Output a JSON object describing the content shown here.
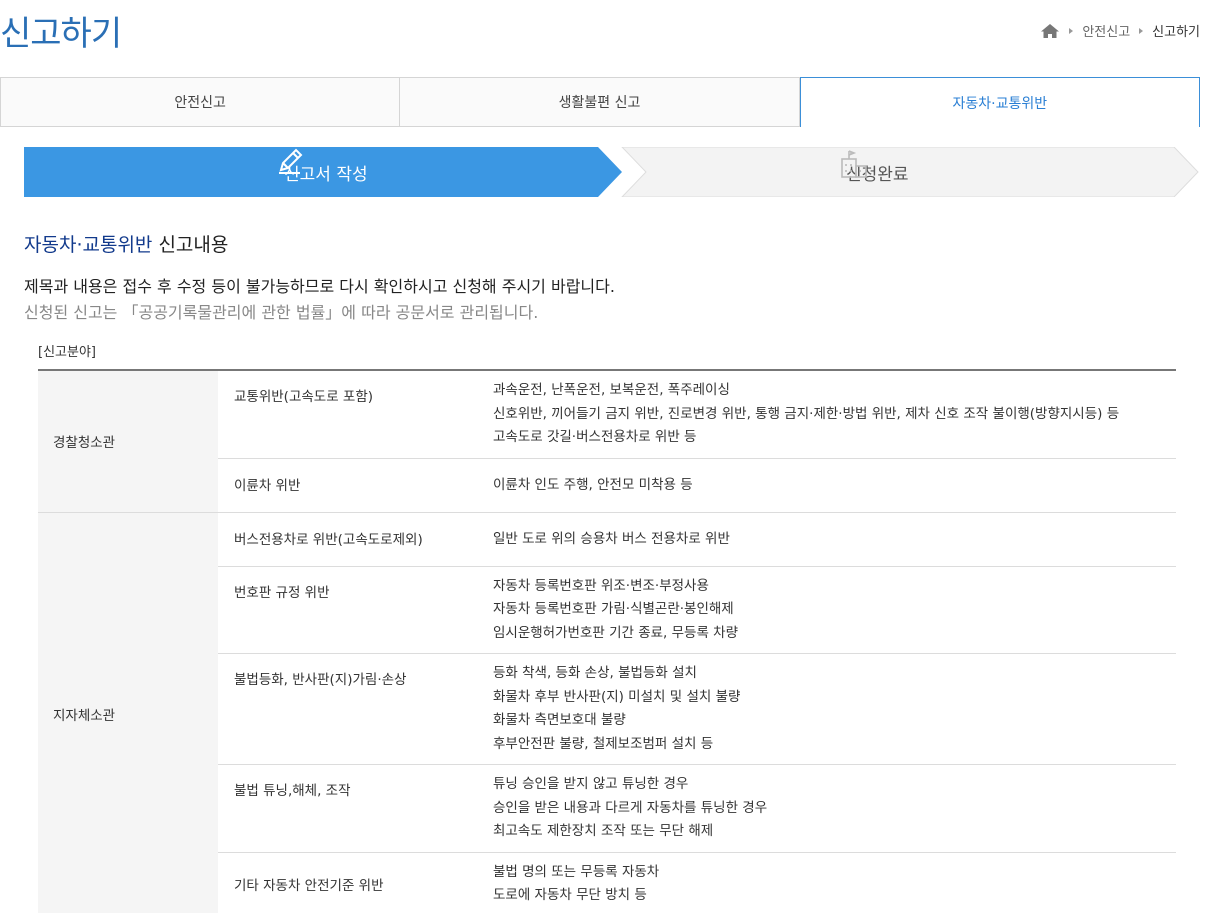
{
  "page": {
    "title": "신고하기",
    "breadcrumb": [
      "안전신고",
      "신고하기"
    ]
  },
  "tabs": [
    {
      "label": "안전신고",
      "active": false
    },
    {
      "label": "생활불편 신고",
      "active": false
    },
    {
      "label": "자동차·교통위반",
      "active": true
    }
  ],
  "steps": [
    {
      "label": "신고서 작성",
      "active": true,
      "icon": "pencil-icon"
    },
    {
      "label": "신청완료",
      "active": false,
      "icon": "building-flag-icon"
    }
  ],
  "section": {
    "title_highlight": "자동차·교통위반",
    "title_rest": " 신고내용",
    "notice_main": "제목과 내용은 접수 후 수정 등이 불가능하므로 다시 확인하시고 신청해 주시기 바랍니다.",
    "notice_sub": "신청된 신고는 「공공기록물관리에 관한 법률」에 따라 공문서로 관리됩니다.",
    "field_label": "[신고분야]"
  },
  "table": {
    "groups": [
      {
        "agency": "경찰청소관",
        "rows": [
          {
            "category": "교통위반(고속도로 포함)",
            "descriptions": [
              "과속운전, 난폭운전, 보복운전, 폭주레이싱",
              "신호위반, 끼어들기 금지 위반, 진로변경 위반, 통행 금지·제한·방법 위반, 제차 신호 조작 불이행(방향지시등) 등",
              "고속도로 갓길·버스전용차로 위반 등"
            ]
          },
          {
            "category": "이륜차 위반",
            "descriptions": [
              "이륜차 인도 주행, 안전모 미착용 등"
            ]
          }
        ]
      },
      {
        "agency": "지자체소관",
        "rows": [
          {
            "category": "버스전용차로 위반(고속도로제외)",
            "descriptions": [
              "일반 도로 위의 승용차 버스 전용차로 위반"
            ]
          },
          {
            "category": "번호판 규정 위반",
            "descriptions": [
              "자동차 등록번호판 위조·변조·부정사용",
              "자동차 등록번호판 가림·식별곤란·봉인해제",
              "임시운행허가번호판 기간 종료, 무등록 차량"
            ]
          },
          {
            "category": "불법등화, 반사판(지)가림·손상",
            "descriptions": [
              "등화 착색, 등화 손상, 불법등화 설치",
              "화물차 후부 반사판(지) 미설치 및 설치 불량",
              "화물차 측면보호대 불량",
              "후부안전판 불량, 철제보조범퍼 설치 등"
            ]
          },
          {
            "category": "불법 튜닝,해체, 조작",
            "descriptions": [
              "튜닝 승인을 받지 않고 튜닝한 경우",
              "승인을 받은 내용과 다르게 자동차를 튜닝한 경우",
              "최고속도 제한장치 조작 또는 무단 해제"
            ]
          },
          {
            "category": "기타 자동차 안전기준 위반",
            "descriptions": [
              "불법 명의 또는 무등록 자동차",
              "도로에 자동차 무단 방치 등"
            ]
          }
        ]
      }
    ]
  },
  "colors": {
    "accent": "#3b97e3",
    "title": "#2a6fb5",
    "highlight": "#123a8c"
  }
}
